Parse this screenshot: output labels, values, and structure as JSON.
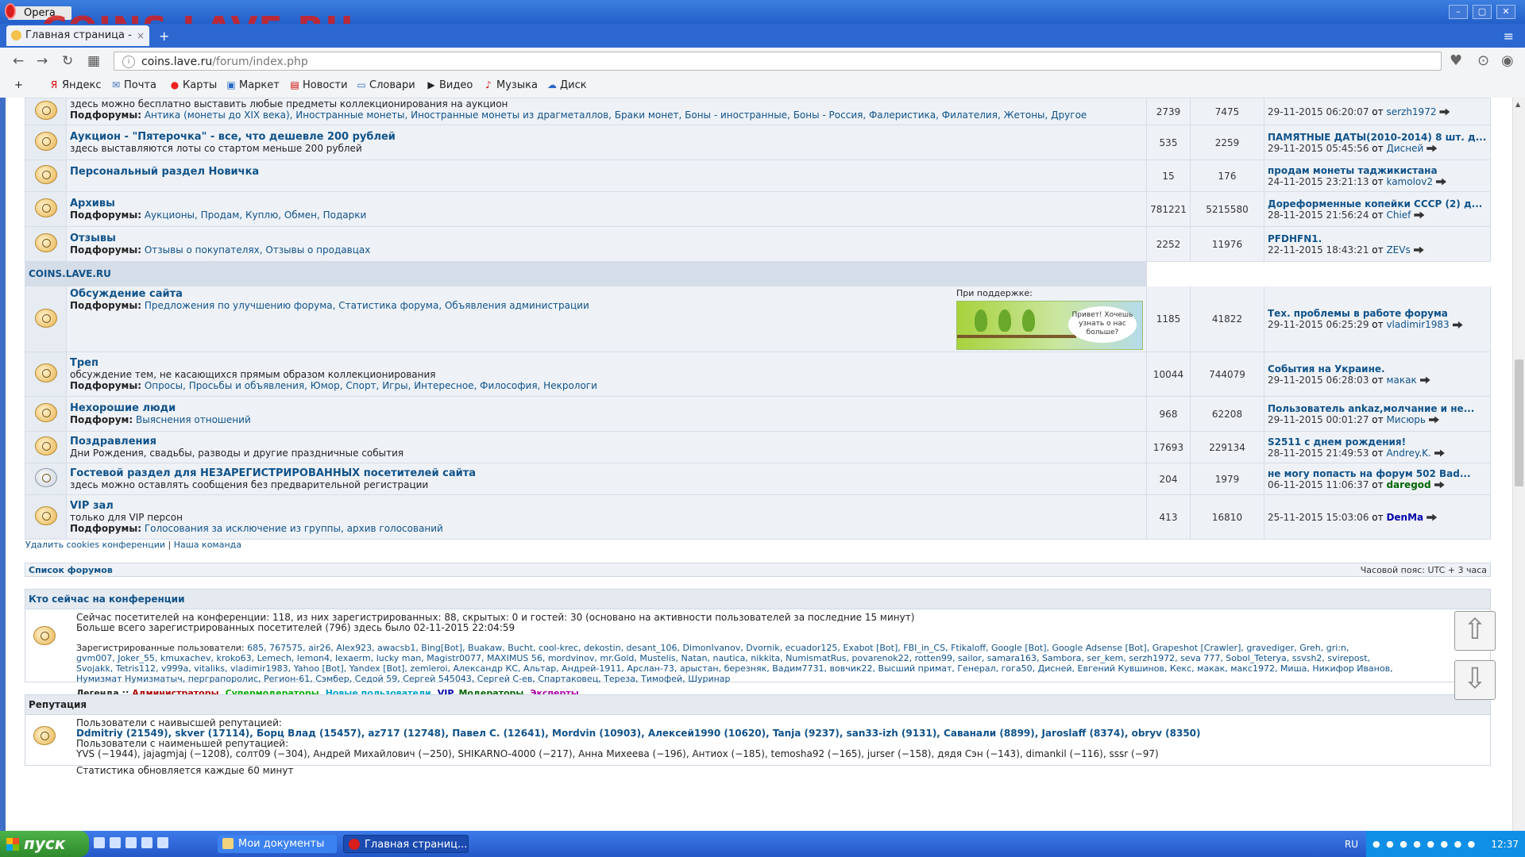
{
  "window": {
    "app_name": "Opera",
    "watermark": "COINS.LAVE.RU"
  },
  "tab": {
    "title": "Главная страница - ",
    "close": "×"
  },
  "address": {
    "url_host": "coins.lave.ru",
    "url_path": "/forum/index.php"
  },
  "bookmarks": [
    {
      "label": "Яндекс"
    },
    {
      "label": "Почта"
    },
    {
      "label": "Карты"
    },
    {
      "label": "Маркет"
    },
    {
      "label": "Новости"
    },
    {
      "label": "Словари"
    },
    {
      "label": "Видео"
    },
    {
      "label": "Музыка"
    },
    {
      "label": "Диск"
    }
  ],
  "forums": [
    {
      "name": "",
      "desc": "здесь можно бесплатно выставить любые предметы коллекционирования на аукцион",
      "sub_label": "Подфорумы:",
      "subs": "Антика (монеты до XIX века), Иностранные монеты, Иностранные монеты из драгметаллов, Браки монет, Боны - иностранные, Боны - Россия, Фалеристика, Филателия, Жетоны, Другое",
      "topics": "2739",
      "posts": "7475",
      "last_title": "",
      "last_date": "29-11-2015 06:20:07",
      "last_by": "от",
      "last_user": "serzh1972"
    },
    {
      "name": "Аукцион - \"Пятерочка\" - все, что дешевле 200 рублей",
      "desc": "здесь выставляются лоты со стартом меньше 200 рублей",
      "sub_label": "",
      "subs": "",
      "topics": "535",
      "posts": "2259",
      "last_title": "ПАМЯТНЫЕ ДАТЫ(2010-2014) 8 шт. д...",
      "last_date": "29-11-2015 05:45:56",
      "last_by": "от",
      "last_user": "Дисней"
    },
    {
      "name": "Персональный раздел Новичка",
      "desc": "",
      "sub_label": "",
      "subs": "",
      "topics": "15",
      "posts": "176",
      "last_title": "продам монеты таджикистана",
      "last_date": "24-11-2015 23:21:13",
      "last_by": "от",
      "last_user": "kamolov2"
    },
    {
      "name": "Архивы",
      "desc": "",
      "sub_label": "Подфорумы:",
      "subs": "Аукционы, Продам, Куплю, Обмен, Подарки",
      "topics": "781221",
      "posts": "5215580",
      "last_title": "Дореформенные копейки СССР (2) д...",
      "last_date": "28-11-2015 21:56:24",
      "last_by": "от",
      "last_user": "Chief"
    },
    {
      "name": "Отзывы",
      "desc": "",
      "sub_label": "Подфорумы:",
      "subs": "Отзывы о покупателях, Отзывы о продавцах",
      "topics": "2252",
      "posts": "11976",
      "last_title": "PFDHFN1.",
      "last_date": "22-11-2015 18:43:21",
      "last_by": "от",
      "last_user": "ZEVs"
    }
  ],
  "category": {
    "name": "COINS.LAVE.RU"
  },
  "sponsor": {
    "label": "При поддержке:",
    "bubble": "Привет! Хочешь узнать о нас больше?"
  },
  "forums2": [
    {
      "name": "Обсуждение сайта",
      "desc": "",
      "sub_label": "Подфорумы:",
      "subs": "Предложения по улучшению форума, Статистика форума, Объявления администрации",
      "topics": "1185",
      "posts": "41822",
      "last_title": "Тех. проблемы в работе форума",
      "last_date": "29-11-2015 06:25:29",
      "last_by": "от",
      "last_user": "vladimir1983"
    },
    {
      "name": "Треп",
      "desc": "обсуждение тем, не касающихся прямым образом коллекционирования",
      "sub_label": "Подфорумы:",
      "subs": "Опросы, Просьбы и объявления, Юмор, Спорт, Игры, Интересное, Философия, Некрологи",
      "topics": "10044",
      "posts": "744079",
      "last_title": "События на Украине.",
      "last_date": "29-11-2015 06:28:03",
      "last_by": "от",
      "last_user": "макак"
    },
    {
      "name": "Нехорошие люди",
      "desc": "",
      "sub_label": "Подфорум:",
      "subs": "Выяснения отношений",
      "topics": "968",
      "posts": "62208",
      "last_title": "Пользователь ankaz,молчание и не...",
      "last_date": "29-11-2015 00:01:27",
      "last_by": "от",
      "last_user": "Мисюрь"
    },
    {
      "name": "Поздравления",
      "desc": "Дни Рождения, свадьбы, разводы и другие праздничные события",
      "sub_label": "",
      "subs": "",
      "topics": "17693",
      "posts": "229134",
      "last_title": "S2511 с днем рождения!",
      "last_date": "28-11-2015 21:49:53",
      "last_by": "от",
      "last_user": "Andrey.K."
    },
    {
      "name": "Гостевой раздел для НЕЗАРЕГИСТРИРОВАННЫХ посетителей сайта",
      "desc": "здесь можно оставлять сообщения без предварительной регистрации",
      "sub_label": "",
      "subs": "",
      "topics": "204",
      "posts": "1979",
      "last_title": "не могу попасть на форум 502 Bad...",
      "last_date": "06-11-2015 11:06:37",
      "last_by": "от",
      "last_user": "daregod"
    },
    {
      "name": "VIP зал",
      "desc": "только для VIP персон",
      "sub_label": "Подфорумы:",
      "subs": "Голосования за исключение из группы, архив голосований",
      "topics": "413",
      "posts": "16810",
      "last_title": "",
      "last_date": "25-11-2015 15:03:06",
      "last_by": "от",
      "last_user": "DenMa"
    }
  ],
  "footer_links": {
    "cookies": "Удалить cookies конференции",
    "sep": "|",
    "team": "Наша команда"
  },
  "navline": {
    "left": "Список форумов",
    "right": "Часовой пояс: UTC + 3 часа"
  },
  "online": {
    "title": "Кто сейчас на конференции",
    "line1": "Сейчас посетителей на конференции: 118, из них зарегистрированных: 88, скрытых: 0 и гостей: 30 (основано на активности пользователей за последние 15 минут)",
    "line2": "Больше всего зарегистрированных посетителей (796) здесь было 02-11-2015 22:04:59",
    "users_label": "Зарегистрированные пользователи:",
    "users1": "685, 767575, air26, Alex923, awacsb1, Bing[Bot], Buakaw, Bucht, cool-krec, dekostin, desant_106, DimonIvanov, Dvornik, ecuador125, Exabot [Bot], FBI_in_CS, Ftikaloff, Google [Bot], Google Adsense [Bot], Grapeshot [Crawler], gravediger, Greh, gri:n,",
    "users2": "gvm007, Joker_55, kmuxachev, kroko63, Lemech, lemon4, lexaerm, lucky man, Magistr0077, MAXIMUS 56, mordvinov, mr.Gold, Mustelis, Natan, nautica, nikkita, NumismatRus, povarenok22, rotten99, sailor, samara163, Sambora, ser_kem, serzh1972, seva 777, Sobol_Teterya, ssvsh2, svirepost,",
    "users3": "Svojakk, Tetris112, v999a, vitaliks, vladimir1983, Yahoo [Bot], Yandex [Bot], zemleroi, Александр КС, Альтар, Андрей-1911, Арслан-73, арыстан, березняк, Вадим7731, вовчик22, Высший примат, Генерал, гога50, Дисней, Евгений Кувшинов, Кекс, макак, макс1972, Миша, Никифор Иванов,",
    "users4": "Нумизмат Нумизматыч, перграпоролис, Регион-61, Сэмбер, Седой 59, Сергей 545043, Сергей С-ев, Спартаковец, Тереза, Тимофей, Шуринар",
    "legend_label": "Легенда ::",
    "legend": {
      "admins": "Администраторы",
      "smods": "Супермодераторы",
      "newu": "Новые пользователи",
      "vip": "VIP",
      "mods": "Модераторы",
      "experts": "Эксперты"
    }
  },
  "reputation": {
    "title": "Репутация",
    "top_label": "Пользователи с наивысшей репутацией:",
    "top": "Ddmitriy (21549), skver (17114), Борц Влад (15457), az717 (12748), Павел С. (12641), Mordvin (10903), Алексей1990 (10620), Tanja (9237), san33-izh (9131), Саванали (8899), Jaroslaff (8374), obryv (8350)",
    "low_label": "Пользователи с наименьшей репутацией:",
    "low": "YVS (−1944), jajagmjaj (−1208), солт09 (−304), Андрей Михайлович (−250), SHIKARNO-4000 (−217), Анна Михеева (−196), Антиох (−185), temosha92 (−165), jurser (−158), дядя Сэн (−143), dimankil (−116), sssr (−97)",
    "note": "Статистика обновляется каждые 60 минут"
  },
  "scroll_buttons": {
    "up": "⇧",
    "down": "⇩"
  },
  "taskbar": {
    "start": "пуск",
    "task1": "Мои документы",
    "task2": "Главная страниц...",
    "lang": "RU",
    "clock": "12:37"
  }
}
